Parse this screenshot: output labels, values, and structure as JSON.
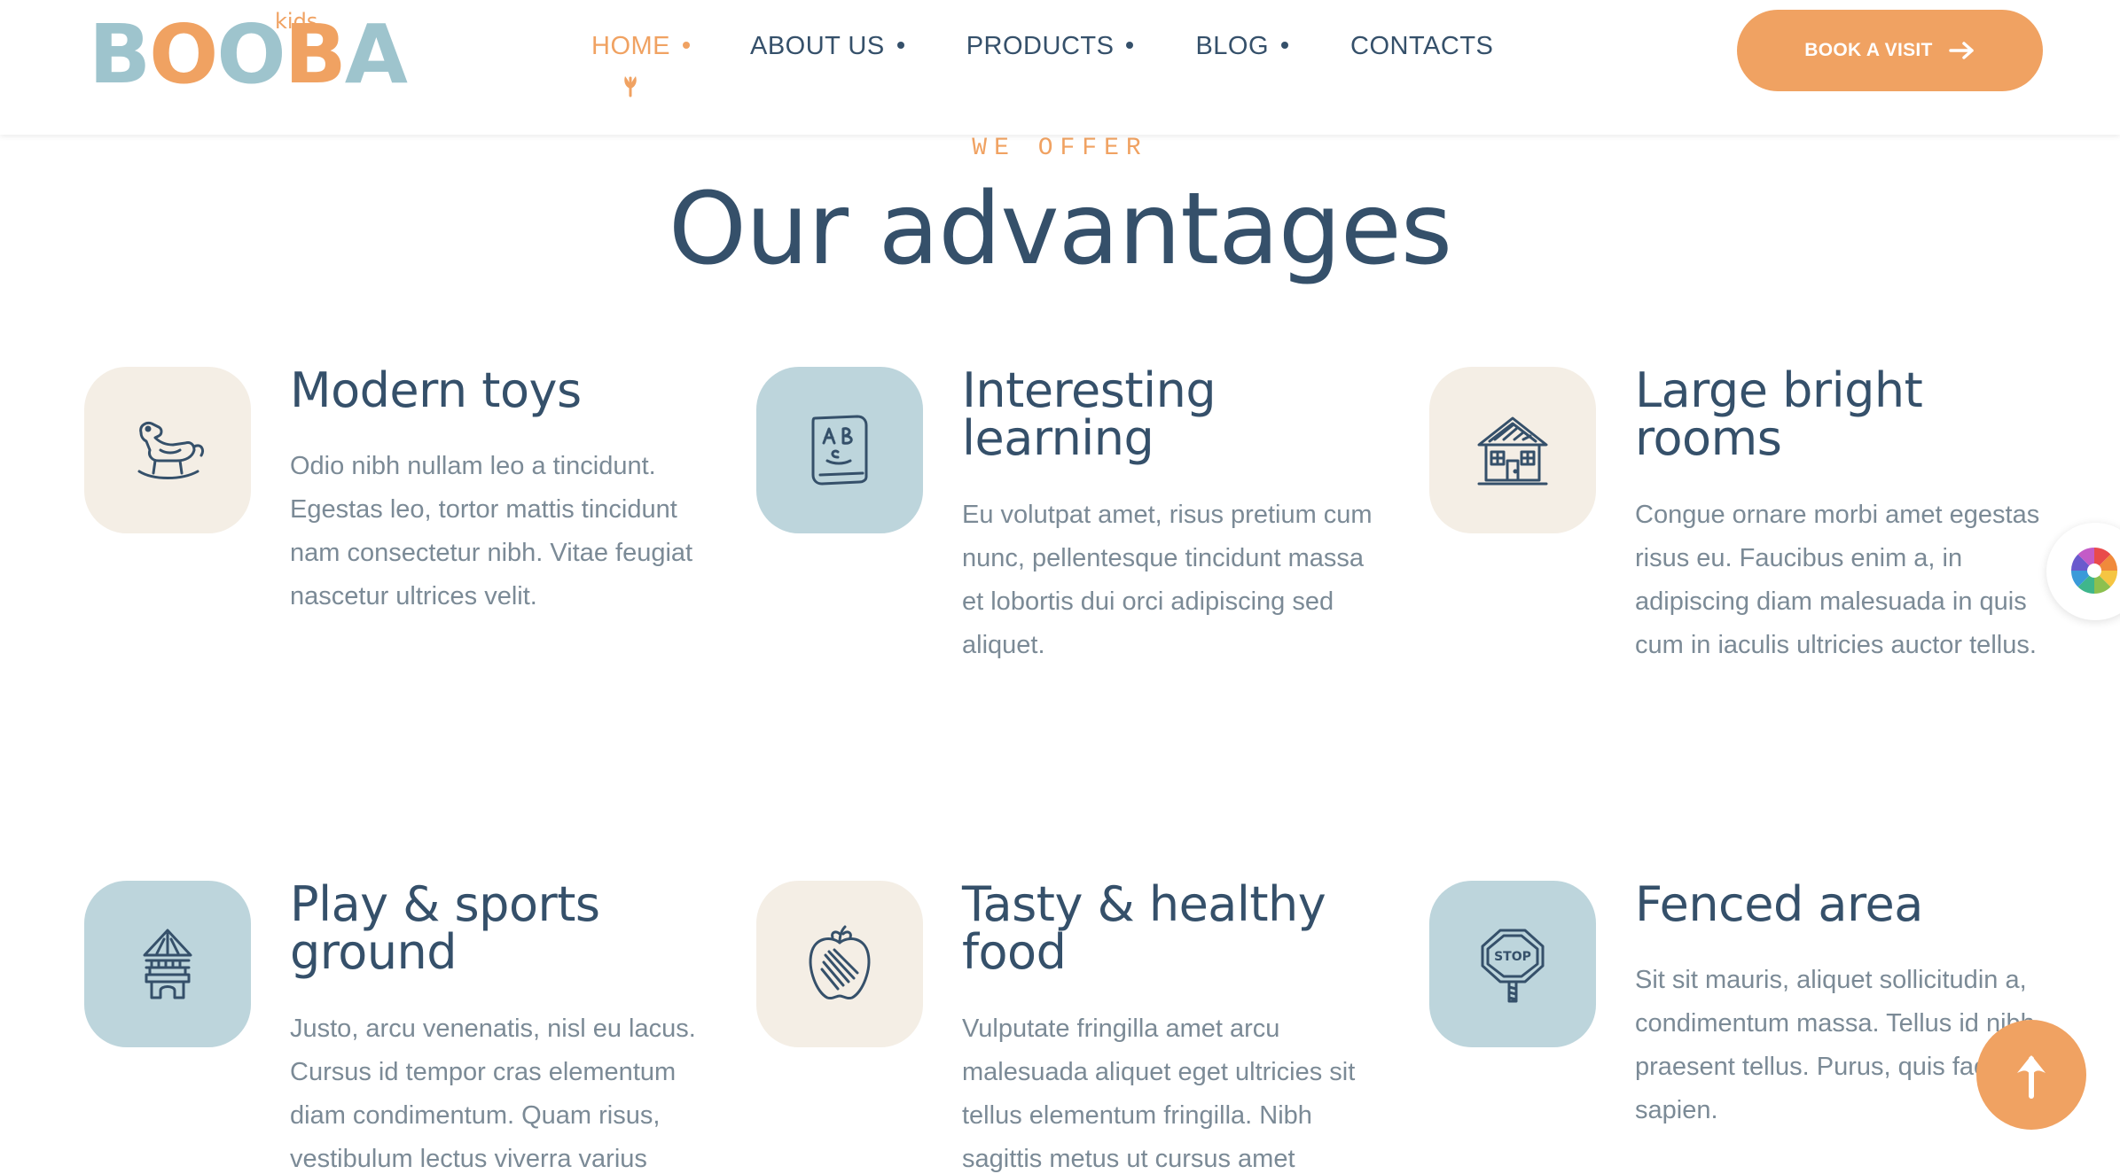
{
  "header": {
    "logo": {
      "main": "BOOBA",
      "sub": "kids"
    },
    "nav": [
      {
        "label": "HOME",
        "active": true
      },
      {
        "label": "ABOUT US",
        "active": false
      },
      {
        "label": "PRODUCTS",
        "active": false
      },
      {
        "label": "BLOG",
        "active": false
      },
      {
        "label": "CONTACTS",
        "active": false
      }
    ],
    "cta_label": "BOOK A VISIT"
  },
  "section": {
    "eyebrow": "WE OFFER",
    "title": "Our advantages"
  },
  "advantages": [
    {
      "title": "Modern toys",
      "text": "Odio nibh nullam leo a tincidunt. Egestas leo, tortor mattis tincidunt nam consectetur nibh. Vitae feugiat nascetur ultrices velit.",
      "icon": "rocking-horse-icon",
      "tile": "beige"
    },
    {
      "title": "Interesting learning",
      "text": "Eu volutpat amet, risus pretium cum nunc, pellentesque tincidunt massa et lobortis dui orci adipiscing sed aliquet.",
      "icon": "abc-book-icon",
      "tile": "blue"
    },
    {
      "title": "Large bright rooms",
      "text": "Congue ornare morbi amet egestas risus eu. Faucibus enim a, in adipiscing diam malesuada in quis cum in iaculis ultricies auctor tellus.",
      "icon": "house-icon",
      "tile": "beige"
    },
    {
      "title": "Play & sports ground",
      "text": "Justo, arcu venenatis, nisl eu lacus. Cursus id tempor cras elementum diam condimentum. Quam risus, vestibulum lectus viverra varius",
      "icon": "playground-tower-icon",
      "tile": "blue"
    },
    {
      "title": "Tasty & healthy food",
      "text": "Vulputate fringilla amet arcu malesuada aliquet eget ultricies sit tellus elementum fringilla. Nibh sagittis metus ut cursus amet",
      "icon": "apple-icon",
      "tile": "beige"
    },
    {
      "title": "Fenced area",
      "text": "Sit sit mauris, aliquet sollicitudin a, condimentum massa. Tellus id nibh praesent tellus. Purus, quis facilisi sapien.",
      "icon": "stop-sign-icon",
      "tile": "blue"
    }
  ],
  "colors": {
    "accent": "#f0a262",
    "navy": "#35506a",
    "body_text": "#7b8a96",
    "tile_beige": "#f4eee5",
    "tile_blue": "#bdd5dc"
  }
}
